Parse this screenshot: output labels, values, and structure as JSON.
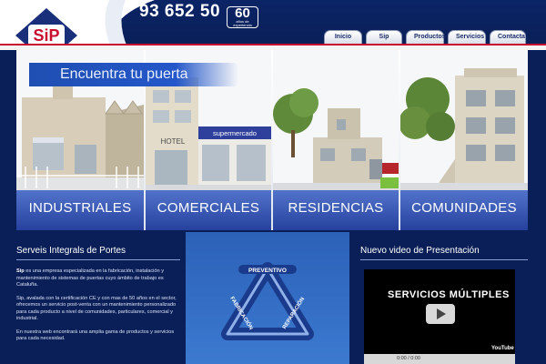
{
  "header": {
    "logo_text": "SiP",
    "phone": "93 652 50",
    "years_badge": {
      "number": "60",
      "line1": "años de",
      "line2": "experiencia"
    }
  },
  "nav": {
    "items": [
      {
        "label": "Inicio"
      },
      {
        "label": "Sip"
      },
      {
        "label": "Productos"
      },
      {
        "label": "Servicios"
      },
      {
        "label": "Contacta"
      }
    ]
  },
  "banner": {
    "title": "Encuentra tu puerta",
    "panels": [
      {
        "label": "INDUSTRIALES"
      },
      {
        "label": "COMERCIALES",
        "sign1": "HOTEL",
        "sign2": "supermercado"
      },
      {
        "label": "RESIDENCIAS"
      },
      {
        "label": "COMUNIDADES"
      }
    ]
  },
  "left_column": {
    "heading": "Serveis Integrals de Portes",
    "para1_bold": "Sip",
    "para1": " es una empresa especializada en la fabricación, instalación y mantenimiento de sistemas de puertas cuyo ámbito de trabajo es Cataluña.",
    "para2": "Sip, avalada con la certificación CE y con mas de 50 años en el sector, ofrecemos un servicio post-venta con un mantenimiento personalizado para cada producto a nivel de comunidades, particulares, comercial y industrial.",
    "para3": "En nuestra web encontrará una amplia gama de productos y servicios para cada necesidad."
  },
  "middle_column": {
    "cycle": {
      "top": "PREVENTIVO",
      "left": "FABRICACIÓN",
      "right": "REPARACIÓN"
    }
  },
  "right_column": {
    "heading": "Nuevo video de Presentación",
    "video": {
      "title": "SERVICIOS MÚLTIPLES",
      "logo": "YouTube",
      "time": "0:00 / 0:00"
    }
  },
  "colors": {
    "page_bg": "#0a1f57",
    "accent_red": "#c8102e",
    "panel_blue": "#1f4fb2"
  }
}
